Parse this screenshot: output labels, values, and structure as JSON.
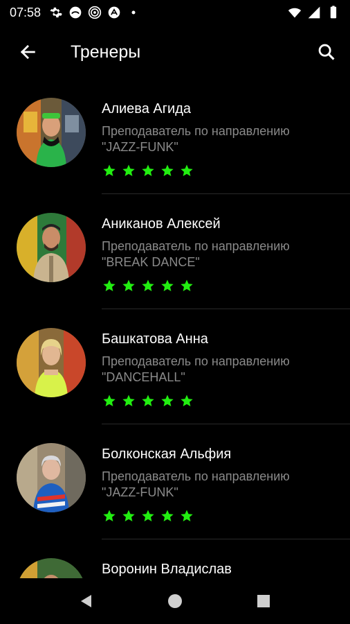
{
  "status_bar": {
    "time": "07:58",
    "left_icons": [
      "gear-icon",
      "cloud-icon",
      "target-icon",
      "accessibility-icon",
      "dot-icon"
    ],
    "right_icons": [
      "wifi-icon",
      "signal-icon",
      "battery-icon"
    ]
  },
  "header": {
    "title": "Тренеры",
    "back_icon": "arrow-left-icon",
    "search_icon": "search-icon"
  },
  "colors": {
    "background": "#000000",
    "accent_star": "#22ee11",
    "secondary_text": "#8a8a8a",
    "divider": "#2a2a2a"
  },
  "trainers": [
    {
      "name": "Алиева Агида",
      "role": "Преподаватель по направлению",
      "style": "\"JAZZ-FUNK\"",
      "rating": 5
    },
    {
      "name": "Аниканов Алексей",
      "role": "Преподаватель по направлению",
      "style": "\"BREAK DANCE\"",
      "rating": 5
    },
    {
      "name": "Башкатова Анна",
      "role": "Преподаватель по направлению",
      "style": "\"DANCEHALL\"",
      "rating": 5
    },
    {
      "name": "Болконская Альфия",
      "role": "Преподаватель по направлению",
      "style": "\"JAZZ-FUNK\"",
      "rating": 5
    },
    {
      "name": "Воронин Владислав",
      "role": "",
      "style": "",
      "rating": null
    }
  ],
  "nav_bar": {
    "buttons": [
      "back-triangle-icon",
      "home-circle-icon",
      "recents-square-icon"
    ]
  }
}
